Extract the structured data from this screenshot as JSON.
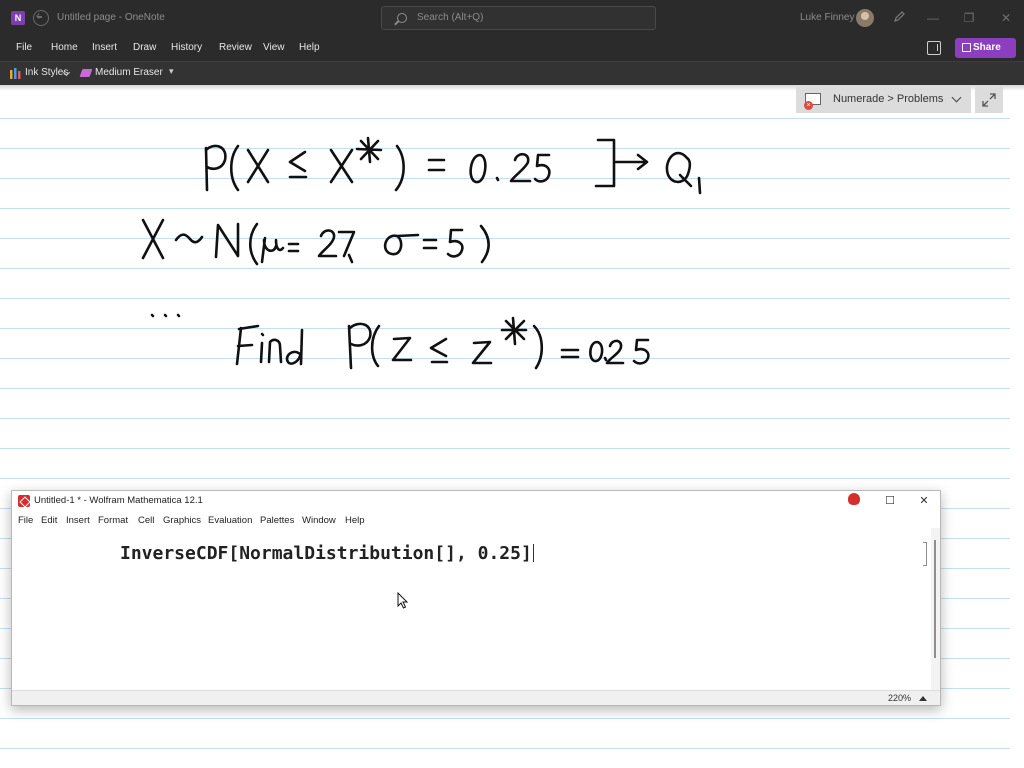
{
  "onenote": {
    "app_logo_letter": "N",
    "doc_title": "Untitled page  -  OneNote",
    "search_placeholder": "Search (Alt+Q)",
    "user_name": "Luke Finney",
    "window_controls": {
      "minimize": "—",
      "restore": "❐",
      "close": "✕"
    },
    "tabs": [
      "File",
      "Home",
      "Insert",
      "Draw",
      "History",
      "Review",
      "View",
      "Help"
    ],
    "share_label": "Share",
    "ribbon": {
      "ink_styles": "Ink Styles",
      "eraser": "Medium Eraser",
      "more": "▾"
    },
    "notebook_chip": {
      "label": "Numerade > Problems",
      "badge": "×"
    },
    "icons": [
      "onenote-logo-icon",
      "back-icon",
      "search-icon",
      "avatar",
      "pen-icon",
      "notebooks-icon",
      "share-icon",
      "ink-styles-icon",
      "eraser-icon",
      "notebook-icon",
      "expand-icon"
    ]
  },
  "mathematica": {
    "window_title": "Untitled-1 * - Wolfram Mathematica 12.1",
    "menus": [
      "File",
      "Edit",
      "Insert",
      "Format",
      "Cell",
      "Graphics",
      "Evaluation",
      "Palettes",
      "Window",
      "Help"
    ],
    "input_expression": "InverseCDF[NormalDistribution[], 0.25]",
    "zoom": "220%",
    "window_controls": {
      "minimize": "",
      "maximize": "☐",
      "close": "✕"
    }
  },
  "colors": {
    "titlebar_bg": "#2b2b2b",
    "share_accent": "#8b3fbf",
    "onenote_purple": "#7b3fb0",
    "rule_line": "#c4dff1",
    "ink": "#111111",
    "mathematica_red": "#d3302d"
  }
}
